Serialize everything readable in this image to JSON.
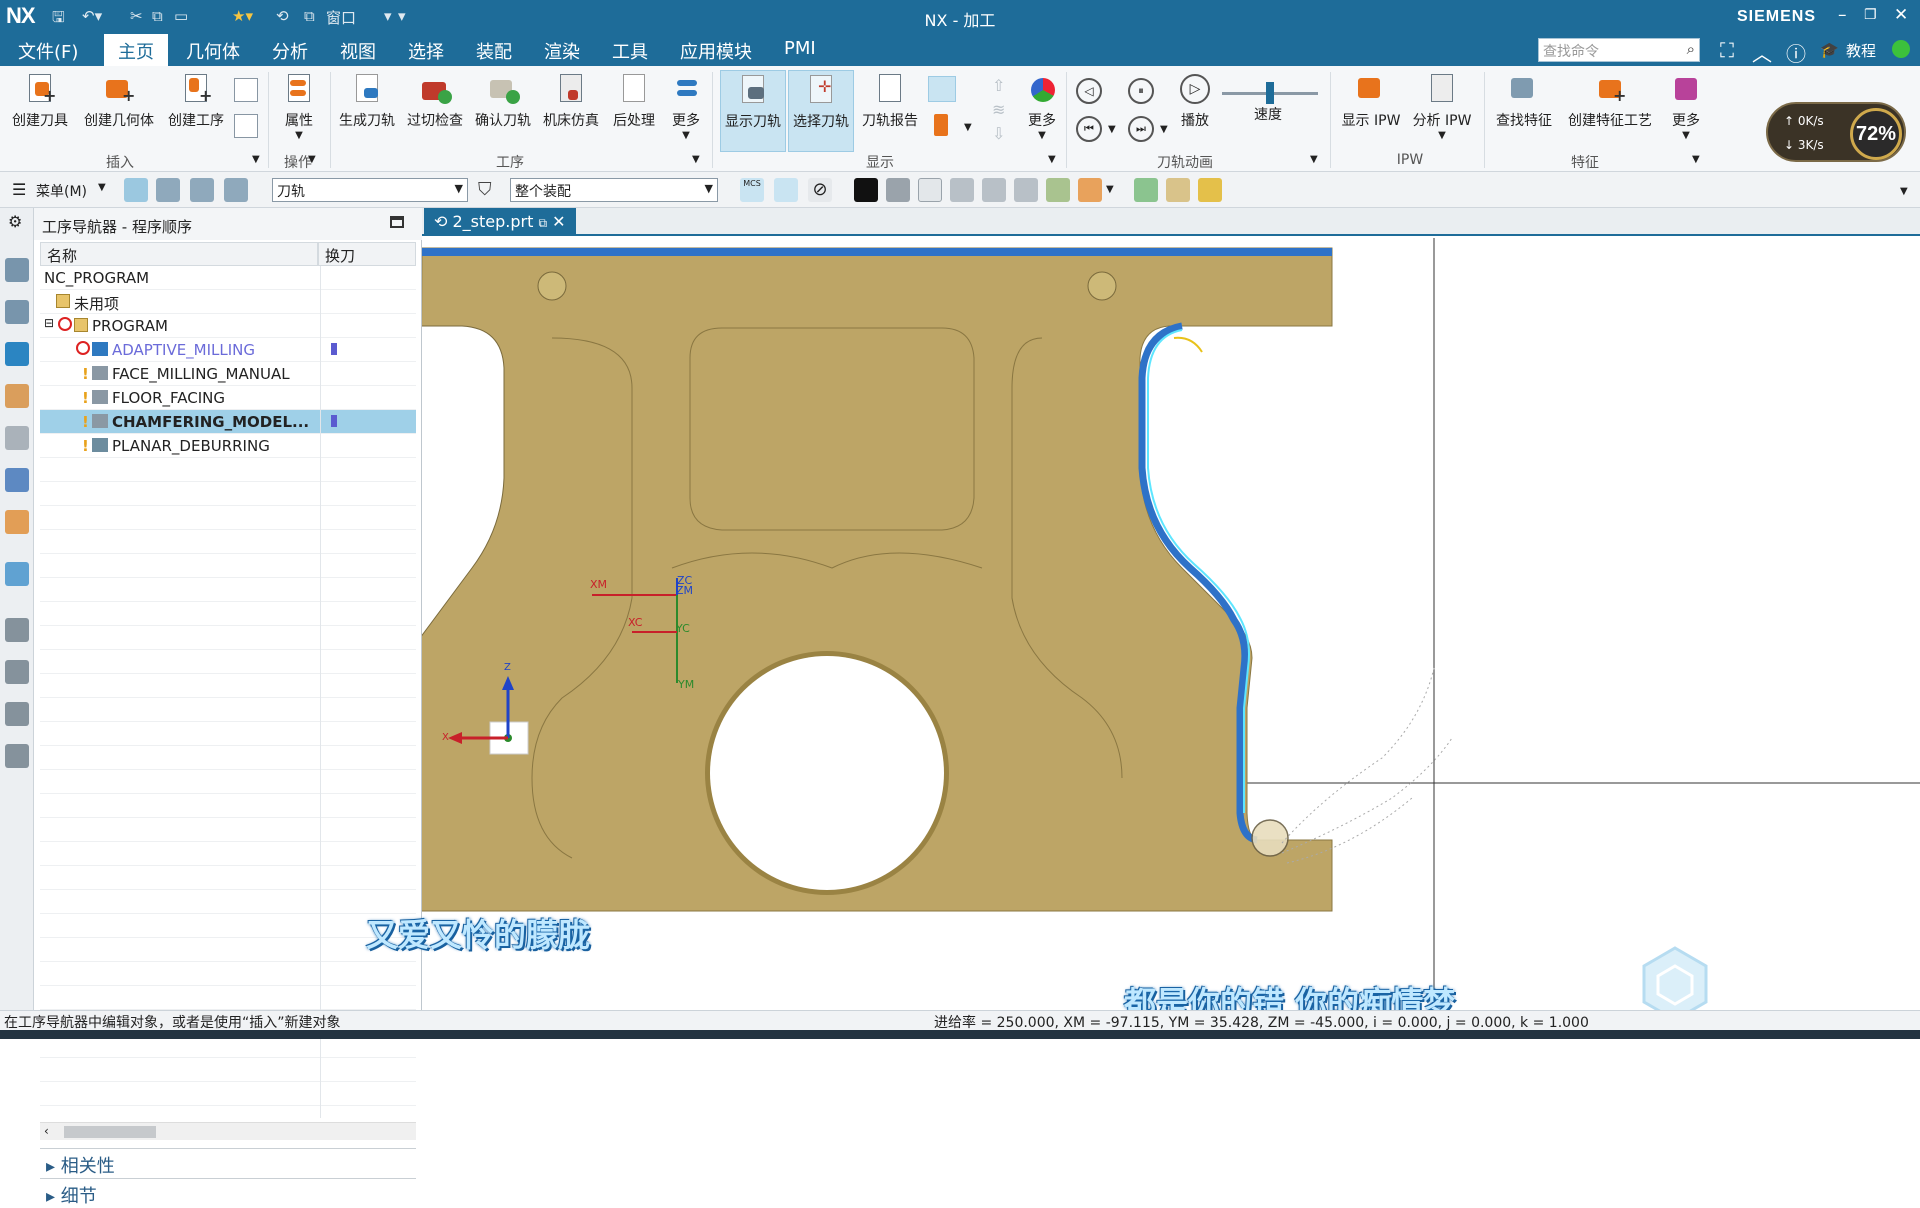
{
  "titlebar": {
    "logo": "NX",
    "title": "NX - 加工",
    "window_menu": "窗口",
    "brand": "SIEMENS",
    "min": "–",
    "restore": "❐",
    "close": "✕"
  },
  "menubar": {
    "items": [
      "文件(F)",
      "主页",
      "几何体",
      "分析",
      "视图",
      "选择",
      "装配",
      "渲染",
      "工具",
      "应用模块",
      "PMI"
    ],
    "active_index": 1,
    "search_placeholder": "查找命令",
    "tutorial": "教程"
  },
  "ribbon": {
    "buttons": [
      "创建刀具",
      "创建几何体",
      "创建工序",
      "属性",
      "生成刀轨",
      "过切检查",
      "确认刀轨",
      "机床仿真",
      "后处理",
      "更多",
      "显示刀轨",
      "选择刀轨",
      "刀轨报告",
      "更多",
      "播放",
      "速度",
      "显示 IPW",
      "分析 IPW",
      "查找特征",
      "创建特征工艺",
      "更多"
    ],
    "groups": [
      "插入",
      "操作",
      "工序",
      "显示",
      "刀轨动画",
      "IPW",
      "特征"
    ]
  },
  "overlay_widget": {
    "percent": "72%",
    "up_speed": "0K/s",
    "down_speed": "3K/s"
  },
  "toolbar2": {
    "menu_label": "菜单(M)",
    "filter_value": "刀轨",
    "scope_value": "整个装配",
    "mcs_label": "MCS"
  },
  "navigator": {
    "title": "工序导航器 - 程序顺序",
    "col_name": "名称",
    "col_tool_change": "换刀",
    "rows": [
      {
        "name": "NC_PROGRAM"
      },
      {
        "name": "未用项"
      },
      {
        "name": "PROGRAM"
      },
      {
        "name": "ADAPTIVE_MILLING"
      },
      {
        "name": "FACE_MILLING_MANUAL"
      },
      {
        "name": "FLOOR_FACING"
      },
      {
        "name": "CHAMFERING_MODEL..."
      },
      {
        "name": "PLANAR_DEBURRING"
      }
    ],
    "sections": [
      "相关性",
      "细节"
    ]
  },
  "viewport": {
    "tab_label": "2_step.prt",
    "axis_labels": {
      "zc": "ZC",
      "zm": "ZM",
      "xm": "XM",
      "xc": "XC",
      "yc": "YC",
      "ym": "YM",
      "z": "Z",
      "x": "X"
    }
  },
  "subtitles": {
    "line1": "又爱又怜的朦胧",
    "line2": "都是你的错 你的痴情梦"
  },
  "status": {
    "left": "在工序导航器中编辑对象，或者是使用“插入”新建对象",
    "right": "进给率 = 250.000, XM = -97.115, YM = 35.428, ZM = -45.000, i = 0.000, j = 0.000, k = 1.000"
  }
}
